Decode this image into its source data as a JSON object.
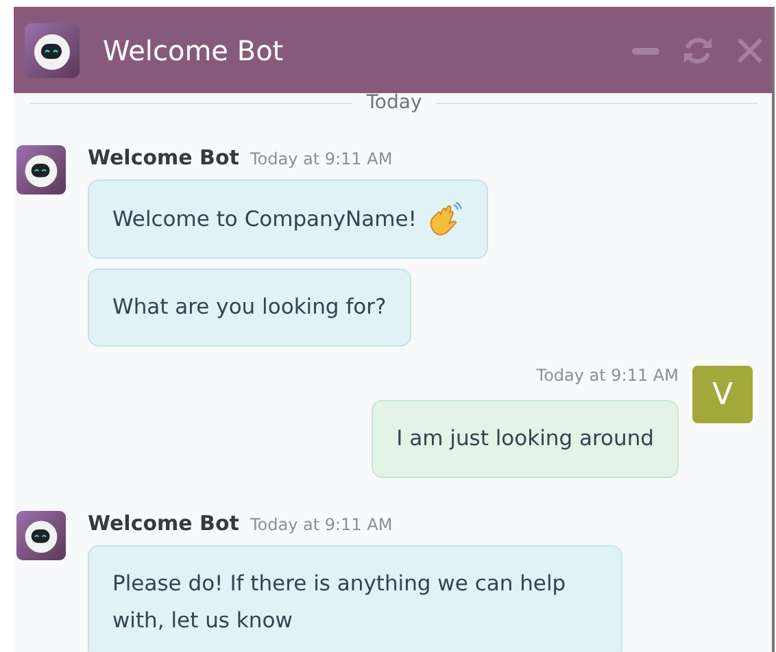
{
  "window": {
    "title": "Welcome Bot"
  },
  "divider": "Today",
  "messages": [
    {
      "kind": "bot",
      "author": "Welcome Bot",
      "time": "Today at 9:11 AM",
      "bubbles": [
        {
          "text": "Welcome to CompanyName!",
          "wave": true
        },
        {
          "text": "What are you looking for?",
          "wave": false
        }
      ]
    },
    {
      "kind": "user",
      "avatar": "V",
      "time": "Today at 9:11 AM",
      "bubbles": [
        {
          "text": "I am just looking around",
          "wave": false
        }
      ]
    },
    {
      "kind": "bot",
      "author": "Welcome Bot",
      "time": "Today at 9:11 AM",
      "bubbles": [
        {
          "text": "Please do! If there is anything we can help with, let us know",
          "wave": false
        }
      ]
    }
  ]
}
